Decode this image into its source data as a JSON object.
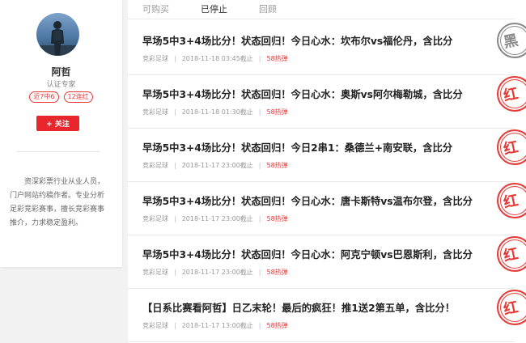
{
  "profile": {
    "name": "阿哲",
    "title": "认证专家",
    "tags": [
      "近7中6",
      "12连红"
    ],
    "follow_label": "+ 关注",
    "description": "资深彩票行业从业人员，门户网站约稿作者。专业分析足彩竞彩赛事，擅长竞彩赛事推介，力求稳定盈利。"
  },
  "tabs": [
    {
      "label": "可购买",
      "active": false
    },
    {
      "label": "已停止",
      "active": true
    },
    {
      "label": "回顾",
      "active": false
    }
  ],
  "articles": [
    {
      "title": "早场5中3+4场比分！状态回归！今日心水：坎布尔vs福伦丹，含比分",
      "category": "竞彩足球",
      "deadline": "2018-11-18 03:45截止",
      "views": "58热弹",
      "stamp": "黑",
      "stamp_color": "#888888"
    },
    {
      "title": "早场5中3+4场比分！状态回归！今日心水：奥斯vs阿尔梅勒城，含比分",
      "category": "竞彩足球",
      "deadline": "2018-11-18 01:30截止",
      "views": "58热弹",
      "stamp": "红",
      "stamp_color": "#e53935"
    },
    {
      "title": "早场5中3+4场比分！状态回归！今日2串1：桑德兰+南安联，含比分",
      "category": "竞彩足球",
      "deadline": "2018-11-17 23:00截止",
      "views": "58热弹",
      "stamp": "红",
      "stamp_color": "#e53935"
    },
    {
      "title": "早场5中3+4场比分！状态回归！今日心水：唐卡斯特vs温布尔登，含比分",
      "category": "竞彩足球",
      "deadline": "2018-11-17 23:00截止",
      "views": "58热弹",
      "stamp": "红",
      "stamp_color": "#e53935"
    },
    {
      "title": "早场5中3+4场比分！状态回归！今日心水：阿克宁顿vs巴恩斯利，含比分",
      "category": "竞彩足球",
      "deadline": "2018-11-17 23:00截止",
      "views": "58热弹",
      "stamp": "红",
      "stamp_color": "#e53935"
    },
    {
      "title": "【日系比赛看阿哲】日乙末轮！最后的疯狂！推1送2第五单，含比分！",
      "category": "竞彩足球",
      "deadline": "2018-11-17 13:00截止",
      "views": "58热弹",
      "stamp": "红",
      "stamp_color": "#e53935"
    }
  ]
}
